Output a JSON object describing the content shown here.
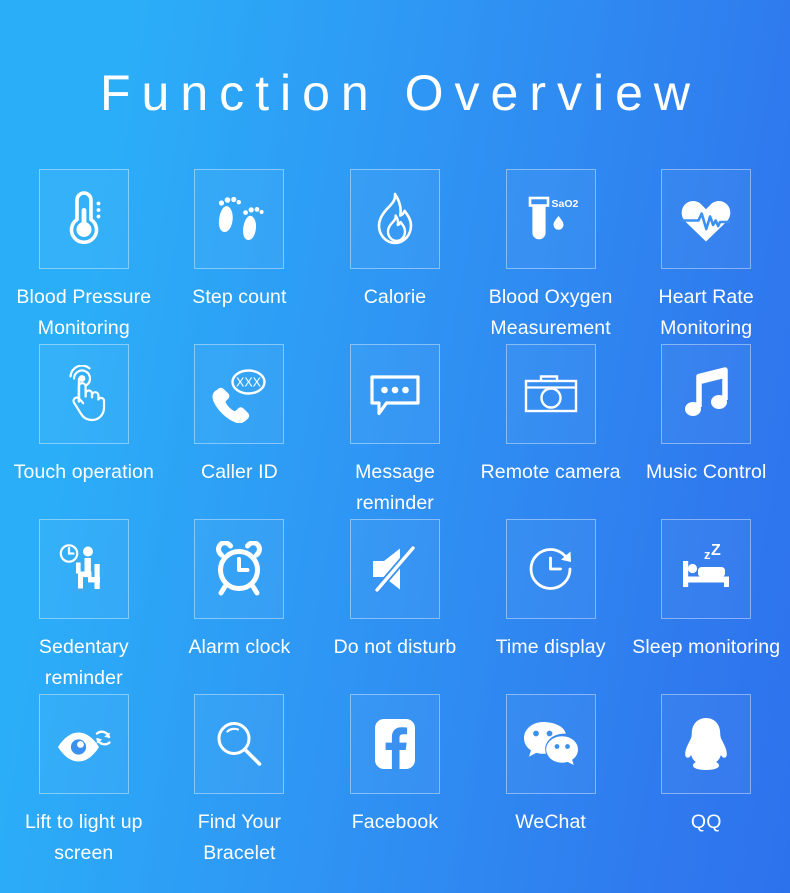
{
  "header": {
    "title": "Function Overview"
  },
  "colors": {
    "gradient_start": "#2BAEF8",
    "gradient_end": "#2D72ED",
    "text": "#FFFFFF",
    "tile_border": "rgba(255,255,255,0.40)"
  },
  "features": [
    {
      "label": "Blood Pressure Monitoring",
      "icon": "thermometer-icon"
    },
    {
      "label": "Step count",
      "icon": "footprints-icon"
    },
    {
      "label": "Calorie",
      "icon": "flame-icon"
    },
    {
      "label": "Blood Oxygen Measurement",
      "icon": "test-tube-sao2-icon",
      "icon_text": "SaO2"
    },
    {
      "label": "Heart Rate Monitoring",
      "icon": "heart-pulse-icon"
    },
    {
      "label": "Touch operation",
      "icon": "touch-hand-icon"
    },
    {
      "label": "Caller ID",
      "icon": "phone-caller-id-icon",
      "icon_text": "XXX"
    },
    {
      "label": "Message reminder",
      "icon": "speech-bubble-icon"
    },
    {
      "label": "Remote camera",
      "icon": "camera-icon"
    },
    {
      "label": "Music Control",
      "icon": "music-note-icon"
    },
    {
      "label": "Sedentary reminder",
      "icon": "sitting-person-clock-icon"
    },
    {
      "label": "Alarm clock",
      "icon": "alarm-clock-icon"
    },
    {
      "label": "Do not disturb",
      "icon": "muted-speaker-icon"
    },
    {
      "label": "Time display",
      "icon": "clock-refresh-icon"
    },
    {
      "label": "Sleep monitoring",
      "icon": "bed-sleep-icon",
      "icon_text": "zZ"
    },
    {
      "label": "Lift to light up screen",
      "icon": "eye-refresh-icon"
    },
    {
      "label": "Find Your Bracelet",
      "icon": "magnifier-icon"
    },
    {
      "label": "Facebook",
      "icon": "facebook-icon"
    },
    {
      "label": "WeChat",
      "icon": "wechat-icon"
    },
    {
      "label": "QQ",
      "icon": "qq-penguin-icon"
    }
  ]
}
